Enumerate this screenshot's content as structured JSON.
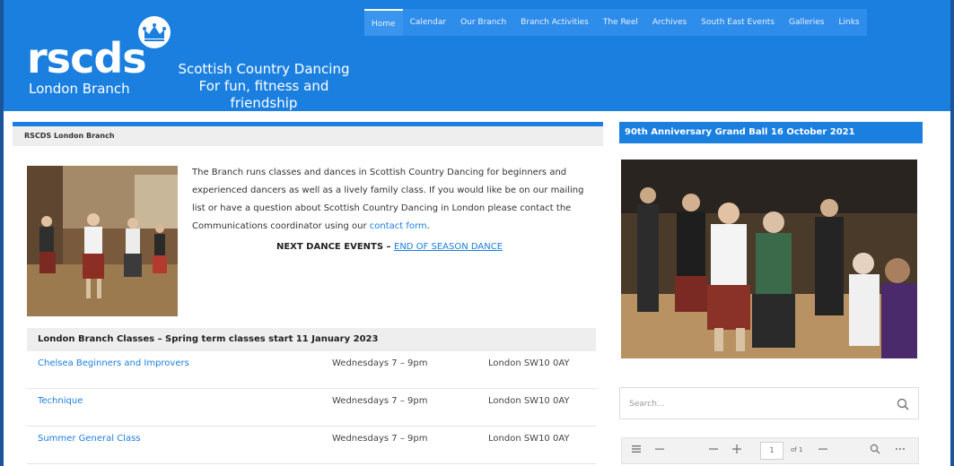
{
  "header": {
    "logo_word": "rscds",
    "logo_sub": "London Branch",
    "tagline_line1": "Scottish Country Dancing",
    "tagline_line2": "For fun, fitness and friendship",
    "nav": [
      "Home",
      "Calendar",
      "Our Branch",
      "Branch Activities",
      "The Reel",
      "Archives",
      "South East Events",
      "Galleries",
      "Links"
    ]
  },
  "main": {
    "heading": "RSCDS London Branch",
    "intro_text": "The Branch runs classes and dances in Scottish Country Dancing for beginners and experienced dancers as well as a lively family class. If you would like be on our mailing list or have a question about Scottish Country Dancing in London please contact the Communications coordinator using our ",
    "contact_link": "contact form",
    "intro_end": ".",
    "next_label": "NEXT DANCE EVENTS – ",
    "next_link": "END OF SEASON DANCE",
    "classes": {
      "heading": "London Branch Classes – Spring term classes start 11 January 2023",
      "rows": [
        {
          "name": "Chelsea Beginners and Improvers",
          "day": "Wednesdays  7 – 9pm",
          "location": "London SW10 0AY"
        },
        {
          "name": "Technique",
          "day": "Wednesdays  7 – 9pm",
          "location": "London SW10 0AY"
        },
        {
          "name": "Summer General Class",
          "day": "Wednesdays 7 – 9pm",
          "location": "London SW10 0AY"
        }
      ]
    }
  },
  "sidebar": {
    "heading": "90th Anniversary Grand Ball 16 October 2021",
    "search_placeholder": "Search...",
    "pdf_page": "1",
    "pdf_of": "of 1"
  },
  "colors": {
    "brand_blue": "#1b7fe0",
    "link": "#1b7fe0"
  }
}
